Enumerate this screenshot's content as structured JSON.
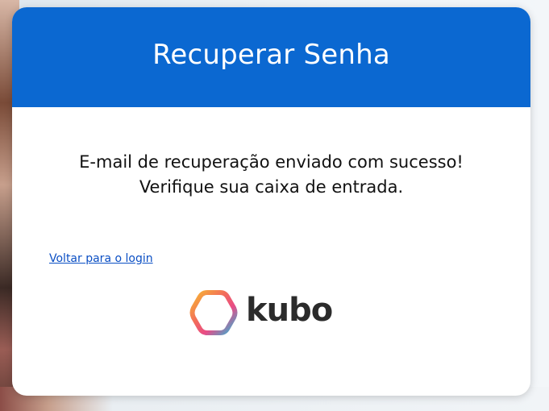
{
  "card": {
    "title": "Recuperar Senha",
    "message_line1": "E-mail de recuperação enviado com sucesso!",
    "message_line2": "Verifique sua caixa de entrada.",
    "back_link": "Voltar para o login"
  },
  "logo": {
    "text": "kubo",
    "icon": "hexagon-gradient-icon"
  },
  "colors": {
    "header": "#0b68d1",
    "link": "#0b4fc4",
    "logo_gradient": [
      "#f7b733",
      "#f26b5b",
      "#e94b86",
      "#2bb6d8"
    ]
  }
}
